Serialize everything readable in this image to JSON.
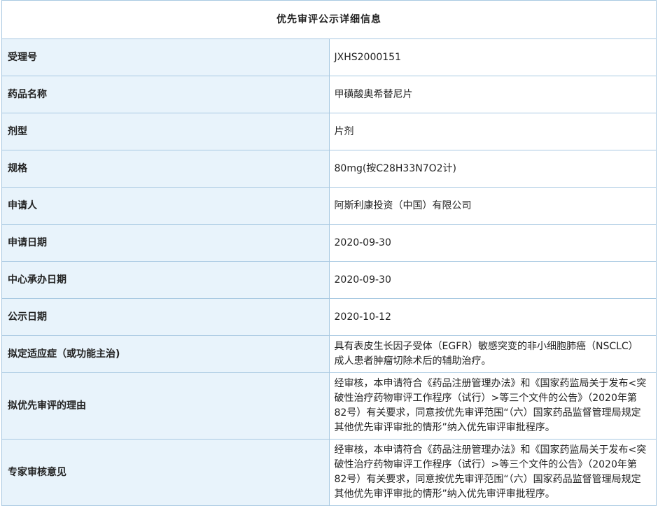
{
  "title": "优先审评公示详细信息",
  "rows": [
    {
      "label": "受理号",
      "value": "JXHS2000151"
    },
    {
      "label": "药品名称",
      "value": "甲磺酸奥希替尼片"
    },
    {
      "label": "剂型",
      "value": "片剂"
    },
    {
      "label": "规格",
      "value": "80mg(按C28H33N7O2计)"
    },
    {
      "label": "申请人",
      "value": "阿斯利康投资（中国）有限公司"
    },
    {
      "label": "申请日期",
      "value": "2020-09-30"
    },
    {
      "label": "中心承办日期",
      "value": "2020-09-30"
    },
    {
      "label": "公示日期",
      "value": "2020-10-12"
    },
    {
      "label": "拟定适应症（或功能主治)",
      "value": "具有表皮生长因子受体（EGFR）敏感突变的非小细胞肺癌（NSCLC）成人患者肿瘤切除术后的辅助治疗。"
    },
    {
      "label": "拟优先审评的理由",
      "value": "经审核，本申请符合《药品注册管理办法》和《国家药监局关于发布<突破性治疗药物审评工作程序（试行）>等三个文件的公告》（2020年第82号）有关要求，同意按优先审评范围“（六）国家药品监督管理局规定其他优先审评审批的情形”纳入优先审评审批程序。"
    },
    {
      "label": "专家审核意见",
      "value": "经审核，本申请符合《药品注册管理办法》和《国家药监局关于发布<突破性治疗药物审评工作程序（试行）>等三个文件的公告》（2020年第82号）有关要求，同意按优先审评范围“（六）国家药品监督管理局规定其他优先审评审批的情形”纳入优先审评审批程序。"
    }
  ]
}
